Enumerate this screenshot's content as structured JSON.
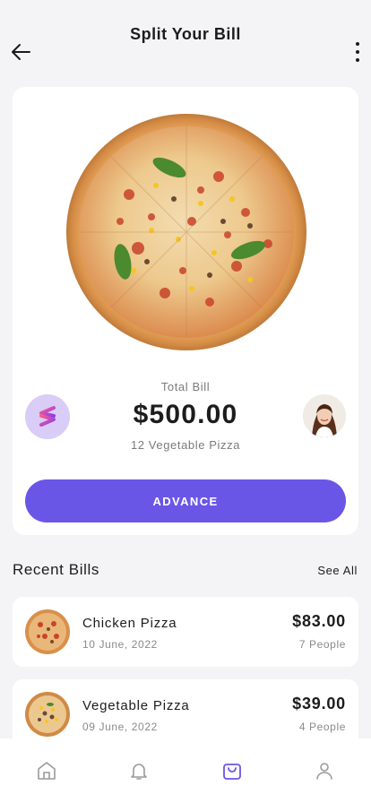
{
  "header": {
    "title": "Split Your Bill",
    "back_icon": "arrow-left-icon",
    "more_icon": "more-vertical-icon"
  },
  "summary": {
    "total_label": "Total Bill",
    "total_amount": "$500.00",
    "subtitle": "12 Vegetable Pizza",
    "action_label": "ADVANCE",
    "accent_color": "#6a56e6"
  },
  "recent": {
    "title": "Recent Bills",
    "see_all": "See All",
    "items": [
      {
        "name": "Chicken Pizza",
        "date": "10 June, 2022",
        "amount": "$83.00",
        "people": "7 People"
      },
      {
        "name": "Vegetable Pizza",
        "date": "09 June, 2022",
        "amount": "$39.00",
        "people": "4 People"
      }
    ]
  },
  "tabbar": {
    "tabs": [
      {
        "icon": "home-icon",
        "active": false
      },
      {
        "icon": "bell-icon",
        "active": false
      },
      {
        "icon": "shopping-bag-icon",
        "active": true
      },
      {
        "icon": "user-icon",
        "active": false
      }
    ]
  }
}
